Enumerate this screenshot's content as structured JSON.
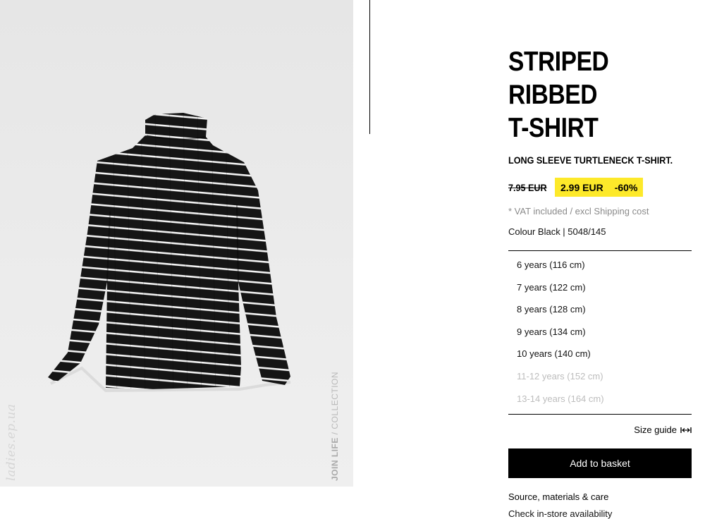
{
  "product": {
    "title_line1": "STRIPED RIBBED",
    "title_line2": "T-SHIRT",
    "subtitle": "LONG SLEEVE TURTLENECK T-SHIRT.",
    "old_price": "7.95 EUR",
    "sale_price": "2.99 EUR",
    "discount": "-60%",
    "vat_note": "* VAT included / excl Shipping cost",
    "colour_line": "Colour Black | 5048/145"
  },
  "sizes": [
    {
      "label": "6 years (116 cm)",
      "available": true
    },
    {
      "label": "7 years (122 cm)",
      "available": true
    },
    {
      "label": "8 years (128 cm)",
      "available": true
    },
    {
      "label": "9 years (134 cm)",
      "available": true
    },
    {
      "label": "10 years (140 cm)",
      "available": true
    },
    {
      "label": "11-12 years (152 cm)",
      "available": false
    },
    {
      "label": "13-14 years (164 cm)",
      "available": false
    }
  ],
  "actions": {
    "size_guide": "Size guide",
    "add_to_basket": "Add to basket",
    "source_materials": "Source, materials & care",
    "cut_off_link": "Check in-store availability"
  },
  "image_panel": {
    "caption_strong": "JOIN LIFE",
    "caption_rest": " / COLLECTION",
    "watermark": "ladies.ep.ua"
  },
  "colors": {
    "sale_highlight": "#fde92a",
    "button_bg": "#000000",
    "unavailable_text": "#bdbdbd"
  },
  "icons": {
    "size_guide": "ruler-arrows-icon",
    "product_image": "striped-turtleneck-shirt"
  }
}
